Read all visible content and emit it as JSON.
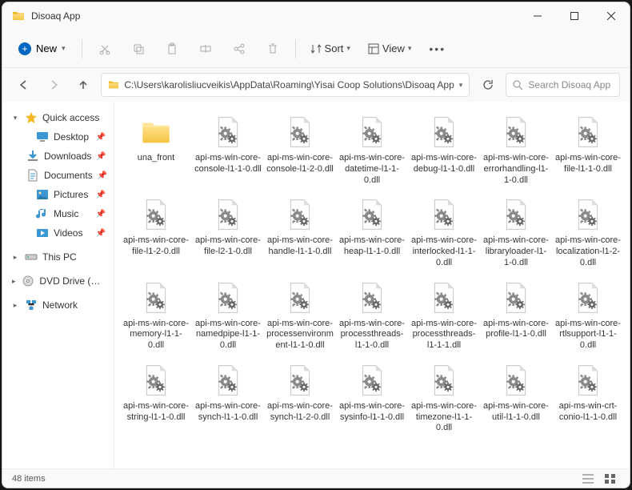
{
  "window": {
    "title": "Disoaq App"
  },
  "toolbar": {
    "new_label": "New",
    "sort_label": "Sort",
    "view_label": "View"
  },
  "address": {
    "path": "C:\\Users\\karolisliucveikis\\AppData\\Roaming\\Yisai Coop Solutions\\Disoaq App",
    "search_placeholder": "Search Disoaq App"
  },
  "sidebar": {
    "quick_access": "Quick access",
    "items": [
      {
        "label": "Desktop"
      },
      {
        "label": "Downloads"
      },
      {
        "label": "Documents"
      },
      {
        "label": "Pictures"
      },
      {
        "label": "Music"
      },
      {
        "label": "Videos"
      }
    ],
    "this_pc": "This PC",
    "dvd": "DVD Drive (D:) CCCC",
    "network": "Network"
  },
  "files": [
    {
      "name": "una_front",
      "type": "folder"
    },
    {
      "name": "api-ms-win-core-console-l1-1-0.dll",
      "type": "dll"
    },
    {
      "name": "api-ms-win-core-console-l1-2-0.dll",
      "type": "dll"
    },
    {
      "name": "api-ms-win-core-datetime-l1-1-0.dll",
      "type": "dll"
    },
    {
      "name": "api-ms-win-core-debug-l1-1-0.dll",
      "type": "dll"
    },
    {
      "name": "api-ms-win-core-errorhandling-l1-1-0.dll",
      "type": "dll"
    },
    {
      "name": "api-ms-win-core-file-l1-1-0.dll",
      "type": "dll"
    },
    {
      "name": "api-ms-win-core-file-l1-2-0.dll",
      "type": "dll"
    },
    {
      "name": "api-ms-win-core-file-l2-1-0.dll",
      "type": "dll"
    },
    {
      "name": "api-ms-win-core-handle-l1-1-0.dll",
      "type": "dll"
    },
    {
      "name": "api-ms-win-core-heap-l1-1-0.dll",
      "type": "dll"
    },
    {
      "name": "api-ms-win-core-interlocked-l1-1-0.dll",
      "type": "dll"
    },
    {
      "name": "api-ms-win-core-libraryloader-l1-1-0.dll",
      "type": "dll"
    },
    {
      "name": "api-ms-win-core-localization-l1-2-0.dll",
      "type": "dll"
    },
    {
      "name": "api-ms-win-core-memory-l1-1-0.dll",
      "type": "dll"
    },
    {
      "name": "api-ms-win-core-namedpipe-l1-1-0.dll",
      "type": "dll"
    },
    {
      "name": "api-ms-win-core-processenvironment-l1-1-0.dll",
      "type": "dll"
    },
    {
      "name": "api-ms-win-core-processthreads-l1-1-0.dll",
      "type": "dll"
    },
    {
      "name": "api-ms-win-core-processthreads-l1-1-1.dll",
      "type": "dll"
    },
    {
      "name": "api-ms-win-core-profile-l1-1-0.dll",
      "type": "dll"
    },
    {
      "name": "api-ms-win-core-rtlsupport-l1-1-0.dll",
      "type": "dll"
    },
    {
      "name": "api-ms-win-core-string-l1-1-0.dll",
      "type": "dll"
    },
    {
      "name": "api-ms-win-core-synch-l1-1-0.dll",
      "type": "dll"
    },
    {
      "name": "api-ms-win-core-synch-l1-2-0.dll",
      "type": "dll"
    },
    {
      "name": "api-ms-win-core-sysinfo-l1-1-0.dll",
      "type": "dll"
    },
    {
      "name": "api-ms-win-core-timezone-l1-1-0.dll",
      "type": "dll"
    },
    {
      "name": "api-ms-win-core-util-l1-1-0.dll",
      "type": "dll"
    },
    {
      "name": "api-ms-win-crt-conio-l1-1-0.dll",
      "type": "dll"
    }
  ],
  "status": {
    "count": "48 items"
  }
}
